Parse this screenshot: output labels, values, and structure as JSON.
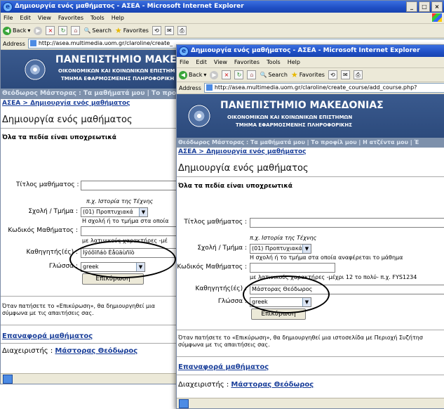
{
  "window_back": {
    "title": "Δημιουργία ενός μαθήματος - ΑΣΕΑ - Microsoft Internet Explorer",
    "window_buttons": [
      "_",
      "□",
      "×"
    ],
    "menu": [
      "File",
      "Edit",
      "View",
      "Favorites",
      "Tools",
      "Help"
    ],
    "toolbar": {
      "back": "Back",
      "search": "Search",
      "favorites": "Favorites"
    },
    "address_label": "Address",
    "address_url": "http://asea.multimedia.uom.gr/claroline/create_",
    "banner": {
      "university": "ΠΑΝΕΠΙΣΤΗΜΙΟ ΜΑΚΕΔΟΝ",
      "line1": "ΟΙΚΟΝΟΜΙΚΩΝ ΚΑΙ ΚΟΙΝΩΝΙΚΩΝ ΕΠΙΣΤΗΜ",
      "line2": "ΤΜΗΜΑ ΕΦΑΡΜΟΣΜΕΝΗΣ ΠΛΗΡΟΦΟΡΙΚΗ"
    },
    "navbar": "Θεόδωρος Μάστορας : Τα μαθήματά μου | Το προ",
    "breadcrumb": {
      "home": "ΑΣΕΑ",
      "sep": ">",
      "current": "Δημιουργία ενός μαθήματος"
    },
    "heading": "Δημιουργία ενός μαθήματος",
    "required_note": "Όλα τα πεδία είναι υποχρεωτικά",
    "form": {
      "title_label": "Τίτλος μαθήματος :",
      "title_hint": "π.χ. Ιστορία της Τέχνης",
      "school_label": "Σχολή / Τμήμα :",
      "school_value": "(01) Προπτυχιακά",
      "school_hint": "Η σχολή ή το τμήμα στα οποία",
      "code_label": "Κωδικός Μαθήματος :",
      "code_hint": "με λατινικούς χαρακτήρες -μέ",
      "teacher_label": "Καθηγητής(ές) :",
      "teacher_value": "Ìÿóôïñáò Èåüäùñïò",
      "language_label": "Γλώσσα :",
      "language_value": "greek",
      "submit": "Επικύρωση"
    },
    "info_text": "Όταν πατήσετε το «Επικύρωση», θα δημιουργηθεί μια σύμφωνα με τις απαιτήσεις σας.",
    "return_link": "Επαναφορά μαθήματος",
    "admin_label": "Διαχειριστής :",
    "admin_name": "Μάστορας Θεόδωρος"
  },
  "window_front": {
    "title": "Δημιουργία ενός μαθήματος - ΑΣΕΑ - Microsoft Internet Explorer",
    "menu": [
      "File",
      "Edit",
      "View",
      "Favorites",
      "Tools",
      "Help"
    ],
    "toolbar": {
      "back": "Back",
      "search": "Search",
      "favorites": "Favorites"
    },
    "address_label": "Address",
    "address_url": "http://asea.multimedia.uom.gr/claroline/create_course/add_course.php?",
    "banner": {
      "university": "ΠΑΝΕΠΙΣΤΗΜΙΟ ΜΑΚΕΔΟΝΙΑΣ",
      "line1": "ΟΙΚΟΝΟΜΙΚΩΝ ΚΑΙ ΚΟΙΝΩΝΙΚΩΝ ΕΠΙΣΤΗΜΩΝ",
      "line2": "ΤΜΗΜΑ ΕΦΑΡΜΟΣΜΕΝΗΣ ΠΛΗΡΟΦΟΡΙΚΗΣ"
    },
    "navbar": "Θεόδωρος Μάστορας : Τα μαθήματά μου | Το προφίλ μου | Η ατζέντα μου | Έ",
    "breadcrumb": {
      "home": "ΑΣΕΑ",
      "sep": ">",
      "current": "Δημιουργία ενός μαθήματος"
    },
    "heading": "Δημιουργία ενός μαθήματος",
    "required_note": "Όλα τα πεδία είναι υποχρεωτικά",
    "form": {
      "title_label": "Τίτλος μαθήματος :",
      "title_hint": "π.χ. Ιστορία της Τέχνης",
      "school_label": "Σχολή / Τμήμα :",
      "school_value": "(01) Προπτυχιακά",
      "school_hint": "Η σχολή ή το τμήμα στα οποία αναφέρεται το μάθημα",
      "code_label": "Κωδικός Μαθήματος :",
      "code_hint": "με λατινικούς χαρακτήρες -μέχρι 12 το πολύ- π.χ. FYS1234",
      "teacher_label": "Καθηγητής(ές) :",
      "teacher_value": "Μάστορας Θεόδωρος",
      "language_label": "Γλώσσα :",
      "language_value": "greek",
      "submit": "Επικύρωση"
    },
    "info_text": "Όταν πατήσετε το «Επικύρωση», θα δημιουργηθεί μια ιστοσελίδα με Περιοχή Συζήτησ σύμφωνα με τις απαιτήσεις σας.",
    "return_link": "Επαναφορά μαθήματος",
    "admin_label": "Διαχειριστής :",
    "admin_name": "Μάστορας Θεόδωρος"
  }
}
